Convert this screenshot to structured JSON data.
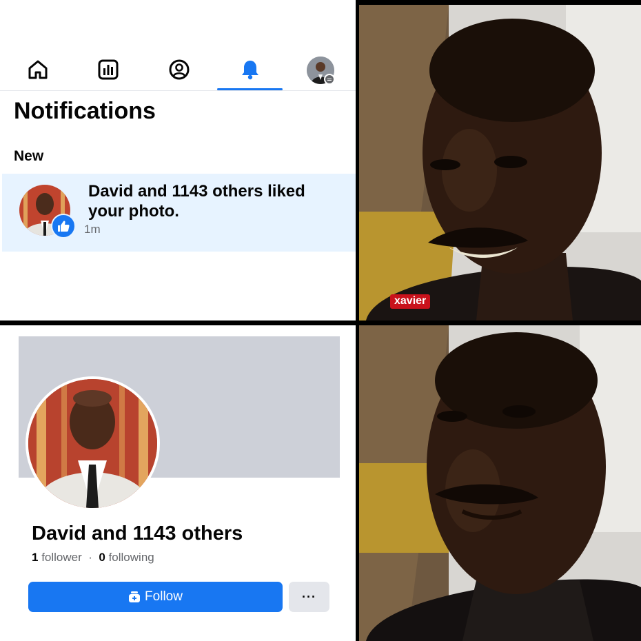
{
  "notifications_panel": {
    "nav": [
      {
        "icon": "home-icon"
      },
      {
        "icon": "dashboard-icon"
      },
      {
        "icon": "profile-icon"
      },
      {
        "icon": "bell-icon",
        "active": true
      },
      {
        "icon": "avatar"
      }
    ],
    "title": "Notifications",
    "section_label": "New",
    "notification": {
      "text": "David and 1143 others liked your photo.",
      "time": "1m",
      "badge_icon": "thumbs-up-icon"
    },
    "colors": {
      "accent": "#1877f2",
      "unread_bg": "#e7f3ff"
    }
  },
  "profile_panel": {
    "name": "David and 1143 others",
    "followers_count": "1",
    "followers_label": "follower",
    "separator": "·",
    "following_count": "0",
    "following_label": "following",
    "follow_button": "Follow",
    "more_button": "···"
  },
  "top_photo": {
    "watermark": "xavier",
    "expression": "smiling"
  },
  "bottom_photo": {
    "expression": "disappointed"
  }
}
